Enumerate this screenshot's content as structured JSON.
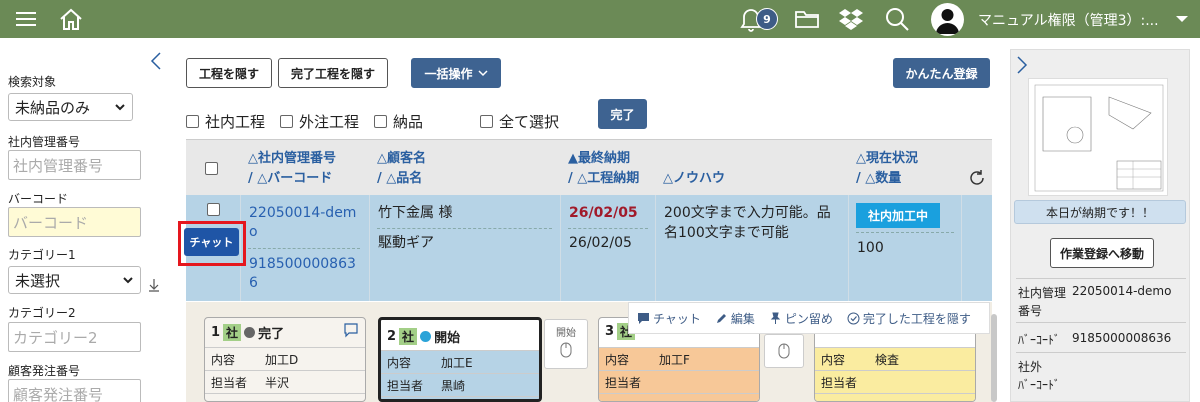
{
  "header": {
    "notification_count": "9",
    "user_name": "マニュアル権限（管理3）:..."
  },
  "sidebar": {
    "search_target_label": "検索対象",
    "search_target_value": "未納品のみ",
    "mgmt_no_label": "社内管理番号",
    "mgmt_no_placeholder": "社内管理番号",
    "barcode_label": "バーコード",
    "barcode_placeholder": "バーコード",
    "category1_label": "カテゴリー1",
    "category1_value": "未選択",
    "category2_label": "カテゴリー2",
    "category2_placeholder": "カテゴリー2",
    "customer_order_label": "顧客発注番号",
    "customer_order_placeholder": "顧客発注番号"
  },
  "toolbar": {
    "hide_process": "工程を隠す",
    "hide_done_process": "完了工程を隠す",
    "bulk_action": "一括操作",
    "easy_register": "かんたん登録",
    "complete": "完了"
  },
  "filters": {
    "internal": "社内工程",
    "external": "外注工程",
    "delivery": "納品",
    "select_all": "全て選択"
  },
  "table": {
    "headers": {
      "mgmt_no": "△社内管理番号",
      "barcode": "/ △バーコード",
      "customer": "△顧客名",
      "item": "/ △品名",
      "final_due": "▲最終納期",
      "process_due": "/ △工程納期",
      "knowhow": "△ノウハウ",
      "status": "△現在状況",
      "qty": "/ △数量"
    },
    "row": {
      "mgmt_no_1": "22050014-dem",
      "mgmt_no_2": "o",
      "barcode_1": "918500000863",
      "barcode_2": "6",
      "customer": "竹下金属 様",
      "item": "駆動ギア",
      "final_due": "26/02/05",
      "process_due": "26/02/05",
      "knowhow": "200文字まで入力可能。品名100文字まで可能",
      "status": "社内加工中",
      "qty": "100",
      "chat": "チャット"
    }
  },
  "process": {
    "actions": {
      "chat": "チャット",
      "edit": "編集",
      "pin": "ピン留め",
      "hide_done": "完了した工程を隠す"
    },
    "start_label": "開始",
    "cards": [
      {
        "no": "1",
        "tag": "社",
        "state": "完了",
        "content_label": "内容",
        "content": "加工D",
        "person_label": "担当者",
        "person": "半沢"
      },
      {
        "no": "2",
        "tag": "社",
        "state": "開始",
        "content_label": "内容",
        "content": "加工E",
        "person_label": "担当者",
        "person": "黒崎"
      },
      {
        "no": "3",
        "tag": "社",
        "content_label": "内容",
        "content": "加工F",
        "person_label": "担当者"
      },
      {
        "content_label": "内容",
        "content": "検査",
        "person_label": "担当者"
      }
    ]
  },
  "right_panel": {
    "due_today": "本日が納期です！！",
    "goto_work": "作業登録へ移動",
    "mgmt_label_1": "社内管理",
    "mgmt_label_2": "番号",
    "mgmt_value": "22050014-demo",
    "barcode_label": "ﾊﾞｰｺｰﾄﾞ",
    "barcode_value": "9185000008636",
    "ext_label_1": "社外",
    "ext_label_2": "ﾊﾞｰｺｰﾄﾞ"
  }
}
